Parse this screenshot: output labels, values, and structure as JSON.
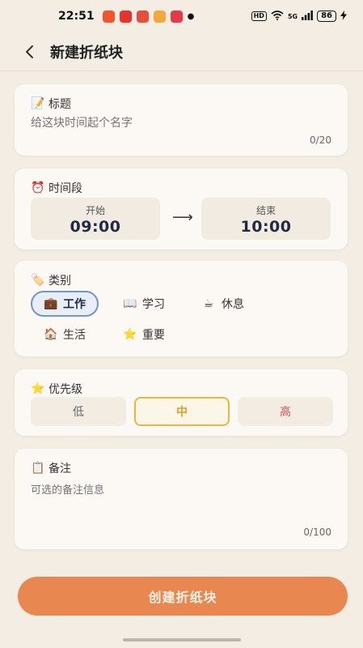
{
  "status_bar": {
    "time": "22:51",
    "network": "5G",
    "hd": "HD",
    "battery": "86",
    "app_icon_colors": [
      "#f0552b",
      "#e8322c",
      "#e84c3d",
      "#f2a93b",
      "#e63946"
    ]
  },
  "header": {
    "title": "新建折纸块",
    "back_icon": "chevron-left-icon"
  },
  "title_card": {
    "label": "标题",
    "label_icon": "📝",
    "placeholder": "给这块时间起个名字",
    "counter": "0/20"
  },
  "time_card": {
    "label": "时间段",
    "label_icon": "⏰",
    "start_caption": "开始",
    "start_value": "09:00",
    "arrow": "⟶",
    "end_caption": "结束",
    "end_value": "10:00"
  },
  "category_card": {
    "label": "类别",
    "label_icon": "🏷️",
    "items": [
      {
        "icon": "💼",
        "label": "工作",
        "selected": true
      },
      {
        "icon": "📖",
        "label": "学习",
        "selected": false
      },
      {
        "icon": "☕",
        "label": "休息",
        "selected": false
      },
      {
        "icon": "🏠",
        "label": "生活",
        "selected": false
      },
      {
        "icon": "⭐",
        "label": "重要",
        "selected": false
      }
    ]
  },
  "priority_card": {
    "label": "优先级",
    "label_icon": "⭐",
    "options": [
      {
        "label": "低",
        "color": "#666666",
        "selected": false
      },
      {
        "label": "中",
        "color": "#e0a020",
        "selected": true
      },
      {
        "label": "高",
        "color": "#d9534f",
        "selected": false
      }
    ]
  },
  "notes_card": {
    "label": "备注",
    "label_icon": "📋",
    "placeholder": "可选的备注信息",
    "counter": "0/100"
  },
  "create_button": {
    "label": "创建折纸块",
    "color": "#e88850"
  }
}
